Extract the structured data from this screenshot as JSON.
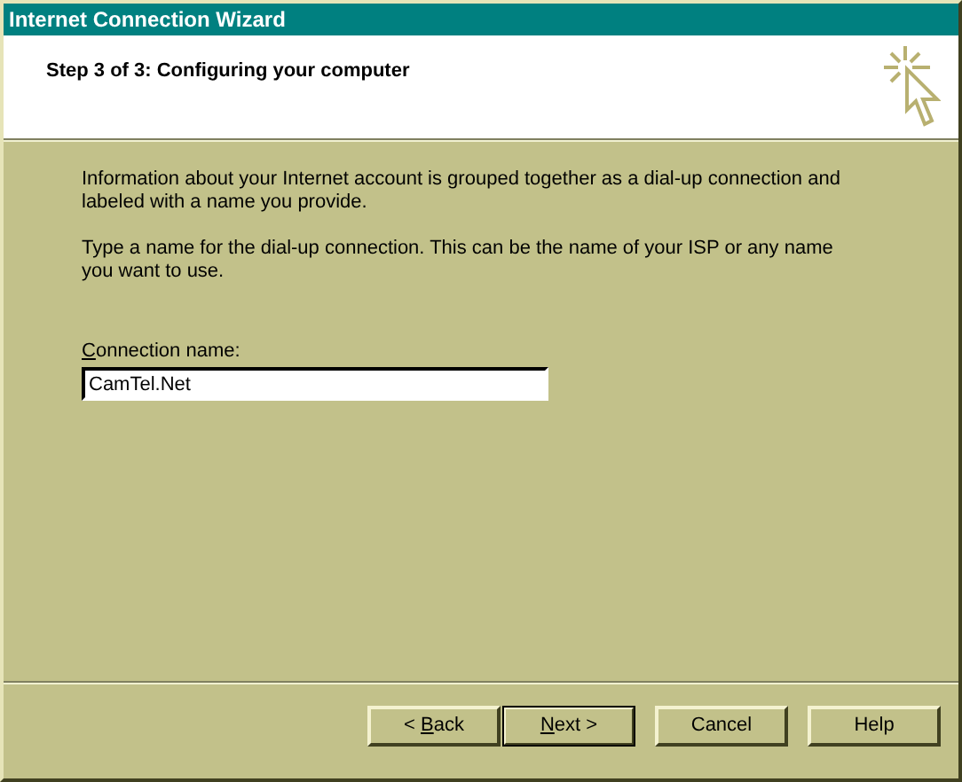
{
  "window": {
    "title": "Internet Connection Wizard"
  },
  "header": {
    "title": "Step 3 of 3: Configuring your computer"
  },
  "paragraphs": [
    "Information about your Internet account is grouped together as a dial-up connection and labeled with a name you provide.",
    "Type a name for the dial-up connection. This can be the name of your ISP or any name you want to use."
  ],
  "field": {
    "label": {
      "key": "C",
      "after": "onnection name:"
    },
    "value": "CamTel.Net"
  },
  "buttons": [
    {
      "label": {
        "before": "< ",
        "key": "B",
        "after": "ack"
      },
      "default": false
    },
    {
      "label": {
        "key": "N",
        "after": "ext >"
      },
      "default": true
    },
    {
      "label": {
        "before": "Cancel"
      },
      "default": false
    },
    {
      "label": {
        "before": "Help"
      },
      "default": false
    }
  ]
}
